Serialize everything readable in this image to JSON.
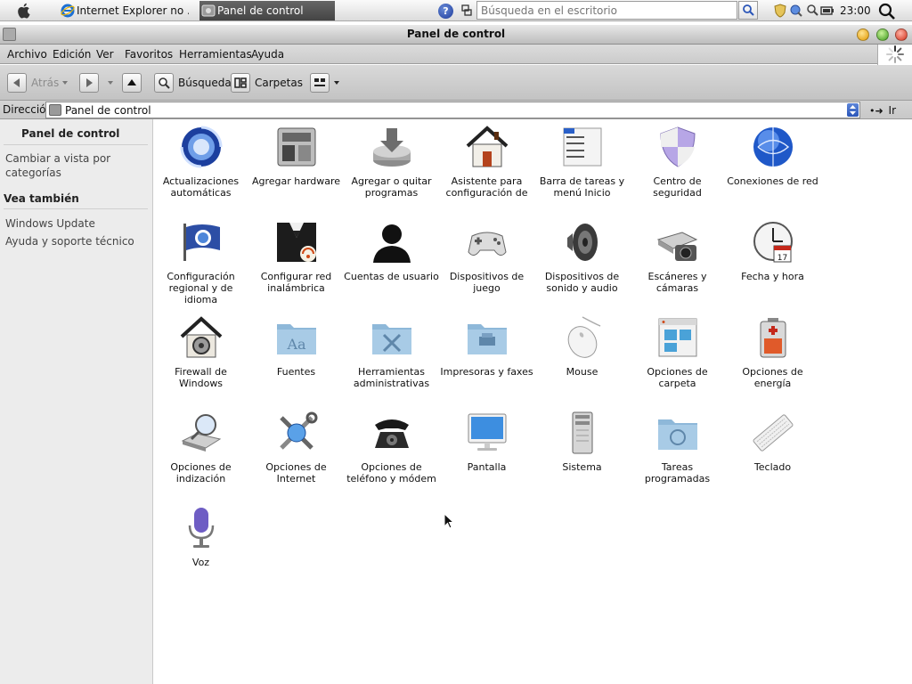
{
  "taskbar": {
    "tasks": [
      {
        "label": "Internet Explorer no ..."
      },
      {
        "label": "Panel de control"
      }
    ],
    "search_placeholder": "Búsqueda en el escritorio",
    "clock": "23:00"
  },
  "window": {
    "title": "Panel de control"
  },
  "menu": [
    "Archivo",
    "Edición",
    "Ver",
    "Favoritos",
    "Herramientas",
    "Ayuda"
  ],
  "toolbar": {
    "back_label": "Atrás",
    "search_label": "Búsqueda",
    "folders_label": "Carpetas"
  },
  "address": {
    "label": "Dirección",
    "value": "Panel de control",
    "go_label": "Ir"
  },
  "sidebar": {
    "header": "Panel de control",
    "switch_view": "Cambiar a vista por categorías",
    "see_also_header": "Vea también",
    "links": [
      "Windows Update",
      "Ayuda y soporte técnico"
    ]
  },
  "items": [
    {
      "label": "Actualizaciones automáticas",
      "icon": "automatic-updates-icon"
    },
    {
      "label": "Agregar hardware",
      "icon": "add-hardware-icon"
    },
    {
      "label": "Agregar o quitar programas",
      "icon": "add-remove-programs-icon"
    },
    {
      "label": "Asistente para configuración de",
      "icon": "setup-wizard-house-icon"
    },
    {
      "label": "Barra de tareas y menú Inicio",
      "icon": "taskbar-start-menu-icon"
    },
    {
      "label": "Centro de seguridad",
      "icon": "security-shield-icon"
    },
    {
      "label": "Conexiones de red",
      "icon": "network-globe-icon"
    },
    {
      "label": "Configuración regional y de idioma",
      "icon": "regional-flag-icon"
    },
    {
      "label": "Configurar red inalámbrica",
      "icon": "wireless-network-icon"
    },
    {
      "label": "Cuentas de usuario",
      "icon": "user-silhouette-icon"
    },
    {
      "label": "Dispositivos de juego",
      "icon": "gamepad-icon"
    },
    {
      "label": "Dispositivos de sonido y audio",
      "icon": "speaker-icon"
    },
    {
      "label": "Escáneres y cámaras",
      "icon": "scanner-camera-icon"
    },
    {
      "label": "Fecha y hora",
      "icon": "clock-calendar-icon"
    },
    {
      "label": "Firewall de Windows",
      "icon": "firewall-house-icon"
    },
    {
      "label": "Fuentes",
      "icon": "fonts-folder-icon"
    },
    {
      "label": "Herramientas administrativas",
      "icon": "admin-tools-folder-icon"
    },
    {
      "label": "Impresoras y faxes",
      "icon": "printer-folder-icon"
    },
    {
      "label": "Mouse",
      "icon": "mouse-icon"
    },
    {
      "label": "Opciones de carpeta",
      "icon": "folder-options-icon"
    },
    {
      "label": "Opciones de energía",
      "icon": "battery-icon"
    },
    {
      "label": "Opciones de indización",
      "icon": "indexing-drive-icon"
    },
    {
      "label": "Opciones de Internet",
      "icon": "internet-tools-icon"
    },
    {
      "label": "Opciones de teléfono y módem",
      "icon": "telephone-icon"
    },
    {
      "label": "Pantalla",
      "icon": "display-monitor-icon"
    },
    {
      "label": "Sistema",
      "icon": "system-tower-icon"
    },
    {
      "label": "Tareas programadas",
      "icon": "scheduled-tasks-folder-icon"
    },
    {
      "label": "Teclado",
      "icon": "keyboard-icon"
    },
    {
      "label": "Voz",
      "icon": "microphone-icon"
    }
  ]
}
